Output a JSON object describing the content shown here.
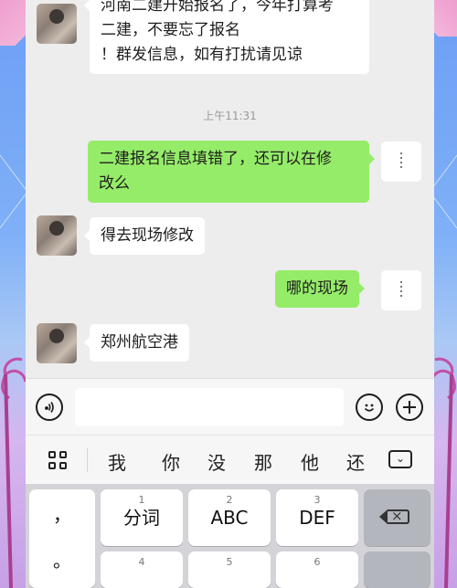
{
  "messages": [
    {
      "side": "in",
      "text": "河南二建开始报名了，今年打算考二建，不要忘了报名！群发信息，如有打扰请见谅"
    },
    {
      "side": "out",
      "text": "二建报名信息填错了，还可以在修改么"
    },
    {
      "side": "in",
      "text": "得去现场修改"
    },
    {
      "side": "out",
      "text": "哪的现场"
    },
    {
      "side": "in",
      "text": "郑州航空港"
    }
  ],
  "first_lines": [
    "河南二建开始报名了，今年打算考",
    "二建，不要忘了报名",
    "！群发信息，如有打扰请见谅"
  ],
  "second_lines": [
    "二建报名信息填错了，还可以在修",
    "改么"
  ],
  "timestamp": "上午11:31",
  "input": {
    "placeholder": ""
  },
  "suggestions": [
    "我",
    "你",
    "没",
    "那",
    "他",
    "还"
  ],
  "keyboard": {
    "punct": [
      "，",
      "。"
    ],
    "row1": [
      {
        "num": "1",
        "label": "分词"
      },
      {
        "num": "2",
        "label": "ABC"
      },
      {
        "num": "3",
        "label": "DEF"
      }
    ],
    "row2_nums": [
      "4",
      "5",
      "6"
    ]
  },
  "colors": {
    "bubble_out": "#95ec69",
    "bubble_in": "#ffffff",
    "chat_bg": "#ededed"
  },
  "icons": [
    "voice-icon",
    "emoji-icon",
    "plus-icon",
    "grid-icon",
    "keyboard-hide-icon",
    "backspace-icon"
  ]
}
